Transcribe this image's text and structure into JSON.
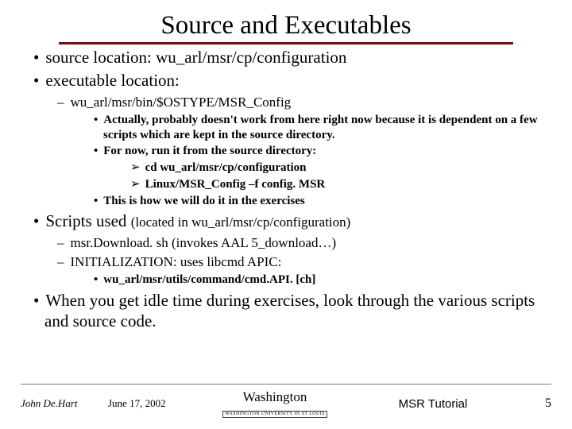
{
  "title": "Source and Executables",
  "bullets": {
    "b1": "source location: wu_arl/msr/cp/configuration",
    "b2": "executable location:",
    "d1": "wu_arl/msr/bin/$OSTYPE/MSR_Config",
    "s1": "Actually, probably doesn't work from here right now because it is dependent on a few scripts which are kept in the source directory.",
    "s2": "For now, run it from the source directory:",
    "a1": "cd wu_arl/msr/cp/configuration",
    "a2": "Linux/MSR_Config –f config. MSR",
    "s3": "This is how we will do it in the exercises",
    "b3a": "Scripts used ",
    "b3b": "(located in wu_arl/msr/cp/configuration)",
    "d2": "msr.Download. sh (invokes AAL 5_download…)",
    "d3": "INITIALIZATION: uses libcmd APIC:",
    "s4": "wu_arl/msr/utils/command/cmd.API. [ch]",
    "b4": "When you get idle time during exercises, look through the various scripts and source code."
  },
  "footer": {
    "author": "John De.Hart",
    "date": "June 17,  2002",
    "university": "Washington",
    "university_sub": "WASHINGTON UNIVERSITY IN ST LOUIS",
    "tutorial": "MSR Tutorial",
    "page": "5"
  }
}
